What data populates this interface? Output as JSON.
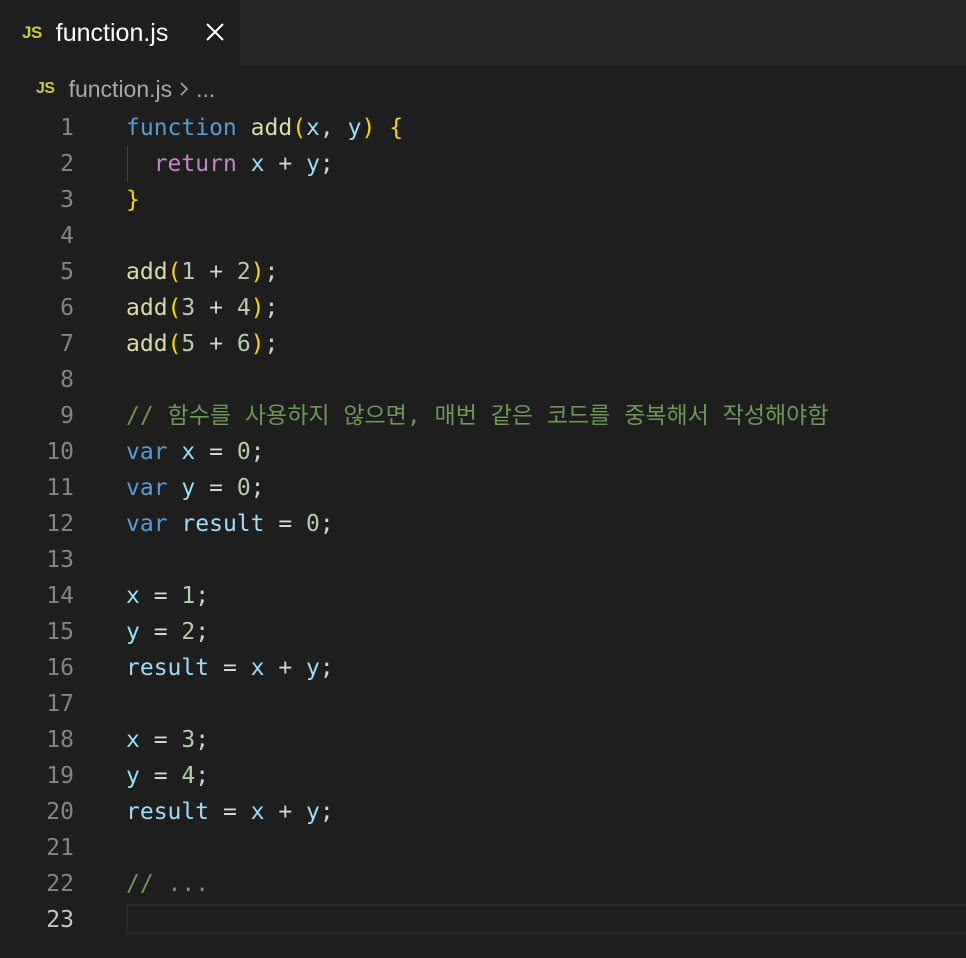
{
  "tab": {
    "badge": "JS",
    "title": "function.js"
  },
  "breadcrumb": {
    "badge": "JS",
    "file": "function.js",
    "more": "..."
  },
  "editor": {
    "active_line": 23,
    "lines": [
      {
        "num": "1",
        "tokens": [
          [
            "kw",
            "function"
          ],
          [
            "op",
            " "
          ],
          [
            "fn",
            "add"
          ],
          [
            "b1",
            "("
          ],
          [
            "var",
            "x"
          ],
          [
            "op",
            ", "
          ],
          [
            "var",
            "y"
          ],
          [
            "b1",
            ")"
          ],
          [
            "op",
            " "
          ],
          [
            "b1",
            "{"
          ]
        ]
      },
      {
        "num": "2",
        "tokens": [
          [
            "op",
            "  "
          ],
          [
            "ctl",
            "return"
          ],
          [
            "op",
            " "
          ],
          [
            "var",
            "x"
          ],
          [
            "op",
            " + "
          ],
          [
            "var",
            "y"
          ],
          [
            "op",
            ";"
          ]
        ]
      },
      {
        "num": "3",
        "tokens": [
          [
            "b1",
            "}"
          ]
        ]
      },
      {
        "num": "4",
        "tokens": []
      },
      {
        "num": "5",
        "tokens": [
          [
            "fn",
            "add"
          ],
          [
            "b1",
            "("
          ],
          [
            "num",
            "1"
          ],
          [
            "op",
            " + "
          ],
          [
            "num",
            "2"
          ],
          [
            "b1",
            ")"
          ],
          [
            "op",
            ";"
          ]
        ]
      },
      {
        "num": "6",
        "tokens": [
          [
            "fn",
            "add"
          ],
          [
            "b1",
            "("
          ],
          [
            "num",
            "3"
          ],
          [
            "op",
            " + "
          ],
          [
            "num",
            "4"
          ],
          [
            "b1",
            ")"
          ],
          [
            "op",
            ";"
          ]
        ]
      },
      {
        "num": "7",
        "tokens": [
          [
            "fn",
            "add"
          ],
          [
            "b1",
            "("
          ],
          [
            "num",
            "5"
          ],
          [
            "op",
            " + "
          ],
          [
            "num",
            "6"
          ],
          [
            "b1",
            ")"
          ],
          [
            "op",
            ";"
          ]
        ]
      },
      {
        "num": "8",
        "tokens": []
      },
      {
        "num": "9",
        "tokens": [
          [
            "cm",
            "// 함수를 사용하지 않으면, 매번 같은 코드를 중복해서 작성해야함"
          ]
        ]
      },
      {
        "num": "10",
        "tokens": [
          [
            "kw",
            "var"
          ],
          [
            "op",
            " "
          ],
          [
            "var",
            "x"
          ],
          [
            "op",
            " = "
          ],
          [
            "num",
            "0"
          ],
          [
            "op",
            ";"
          ]
        ]
      },
      {
        "num": "11",
        "tokens": [
          [
            "kw",
            "var"
          ],
          [
            "op",
            " "
          ],
          [
            "var",
            "y"
          ],
          [
            "op",
            " = "
          ],
          [
            "num",
            "0"
          ],
          [
            "op",
            ";"
          ]
        ]
      },
      {
        "num": "12",
        "tokens": [
          [
            "kw",
            "var"
          ],
          [
            "op",
            " "
          ],
          [
            "var",
            "result"
          ],
          [
            "op",
            " = "
          ],
          [
            "num",
            "0"
          ],
          [
            "op",
            ";"
          ]
        ]
      },
      {
        "num": "13",
        "tokens": []
      },
      {
        "num": "14",
        "tokens": [
          [
            "var",
            "x"
          ],
          [
            "op",
            " = "
          ],
          [
            "num",
            "1"
          ],
          [
            "op",
            ";"
          ]
        ]
      },
      {
        "num": "15",
        "tokens": [
          [
            "var",
            "y"
          ],
          [
            "op",
            " = "
          ],
          [
            "num",
            "2"
          ],
          [
            "op",
            ";"
          ]
        ]
      },
      {
        "num": "16",
        "tokens": [
          [
            "var",
            "result"
          ],
          [
            "op",
            " = "
          ],
          [
            "var",
            "x"
          ],
          [
            "op",
            " + "
          ],
          [
            "var",
            "y"
          ],
          [
            "op",
            ";"
          ]
        ]
      },
      {
        "num": "17",
        "tokens": []
      },
      {
        "num": "18",
        "tokens": [
          [
            "var",
            "x"
          ],
          [
            "op",
            " = "
          ],
          [
            "num",
            "3"
          ],
          [
            "op",
            ";"
          ]
        ]
      },
      {
        "num": "19",
        "tokens": [
          [
            "var",
            "y"
          ],
          [
            "op",
            " = "
          ],
          [
            "num",
            "4"
          ],
          [
            "op",
            ";"
          ]
        ]
      },
      {
        "num": "20",
        "tokens": [
          [
            "var",
            "result"
          ],
          [
            "op",
            " = "
          ],
          [
            "var",
            "x"
          ],
          [
            "op",
            " + "
          ],
          [
            "var",
            "y"
          ],
          [
            "op",
            ";"
          ]
        ]
      },
      {
        "num": "21",
        "tokens": []
      },
      {
        "num": "22",
        "tokens": [
          [
            "cm",
            "// ..."
          ]
        ]
      },
      {
        "num": "23",
        "tokens": []
      }
    ]
  }
}
